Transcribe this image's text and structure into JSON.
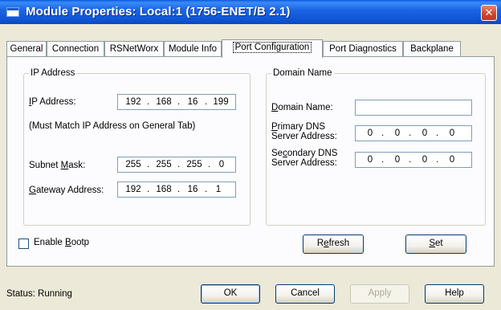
{
  "window": {
    "title": "Module Properties: Local:1 (1756-ENET/B 2.1)",
    "close_glyph": "✕"
  },
  "tabs": [
    {
      "label": "General"
    },
    {
      "label": "Connection"
    },
    {
      "label": "RSNetWorx"
    },
    {
      "label": "Module Info"
    },
    {
      "label": "Port Configuration",
      "active": true
    },
    {
      "label": "Port Diagnostics"
    },
    {
      "label": "Backplane"
    }
  ],
  "ip_group": {
    "legend": "IP Address",
    "ip_label_pre": "",
    "ip_label_u": "I",
    "ip_label_post": "P Address:",
    "ip_value": [
      "192",
      "168",
      "16",
      "199"
    ],
    "note": "(Must Match IP Address on General Tab)",
    "subnet_label_pre": "Subnet ",
    "subnet_label_u": "M",
    "subnet_label_post": "ask:",
    "subnet_value": [
      "255",
      "255",
      "255",
      "0"
    ],
    "gateway_label_pre": "",
    "gateway_label_u": "G",
    "gateway_label_post": "ateway Address:",
    "gateway_value": [
      "192",
      "168",
      "16",
      "1"
    ]
  },
  "domain_group": {
    "legend": "Domain Name",
    "domain_label_pre": "",
    "domain_label_u": "D",
    "domain_label_post": "omain Name:",
    "domain_value": "",
    "primary_line1_pre": "",
    "primary_line1_u": "P",
    "primary_line1_post": "rimary DNS",
    "primary_line2": "Server Address:",
    "primary_value": [
      "0",
      "0",
      "0",
      "0"
    ],
    "secondary_line1_pre": "Se",
    "secondary_line1_u": "c",
    "secondary_line1_post": "ondary DNS",
    "secondary_line2": "Server Address:",
    "secondary_value": [
      "0",
      "0",
      "0",
      "0"
    ]
  },
  "bootp": {
    "label_pre": "Enable ",
    "label_u": "B",
    "label_post": "ootp",
    "checked": false
  },
  "buttons": {
    "refresh_pre": "R",
    "refresh_u": "e",
    "refresh_post": "fresh",
    "set_pre": "",
    "set_u": "S",
    "set_post": "et",
    "ok": "OK",
    "cancel": "Cancel",
    "apply": "Apply",
    "help": "Help"
  },
  "status": {
    "label": "Status:",
    "value": "Running"
  }
}
